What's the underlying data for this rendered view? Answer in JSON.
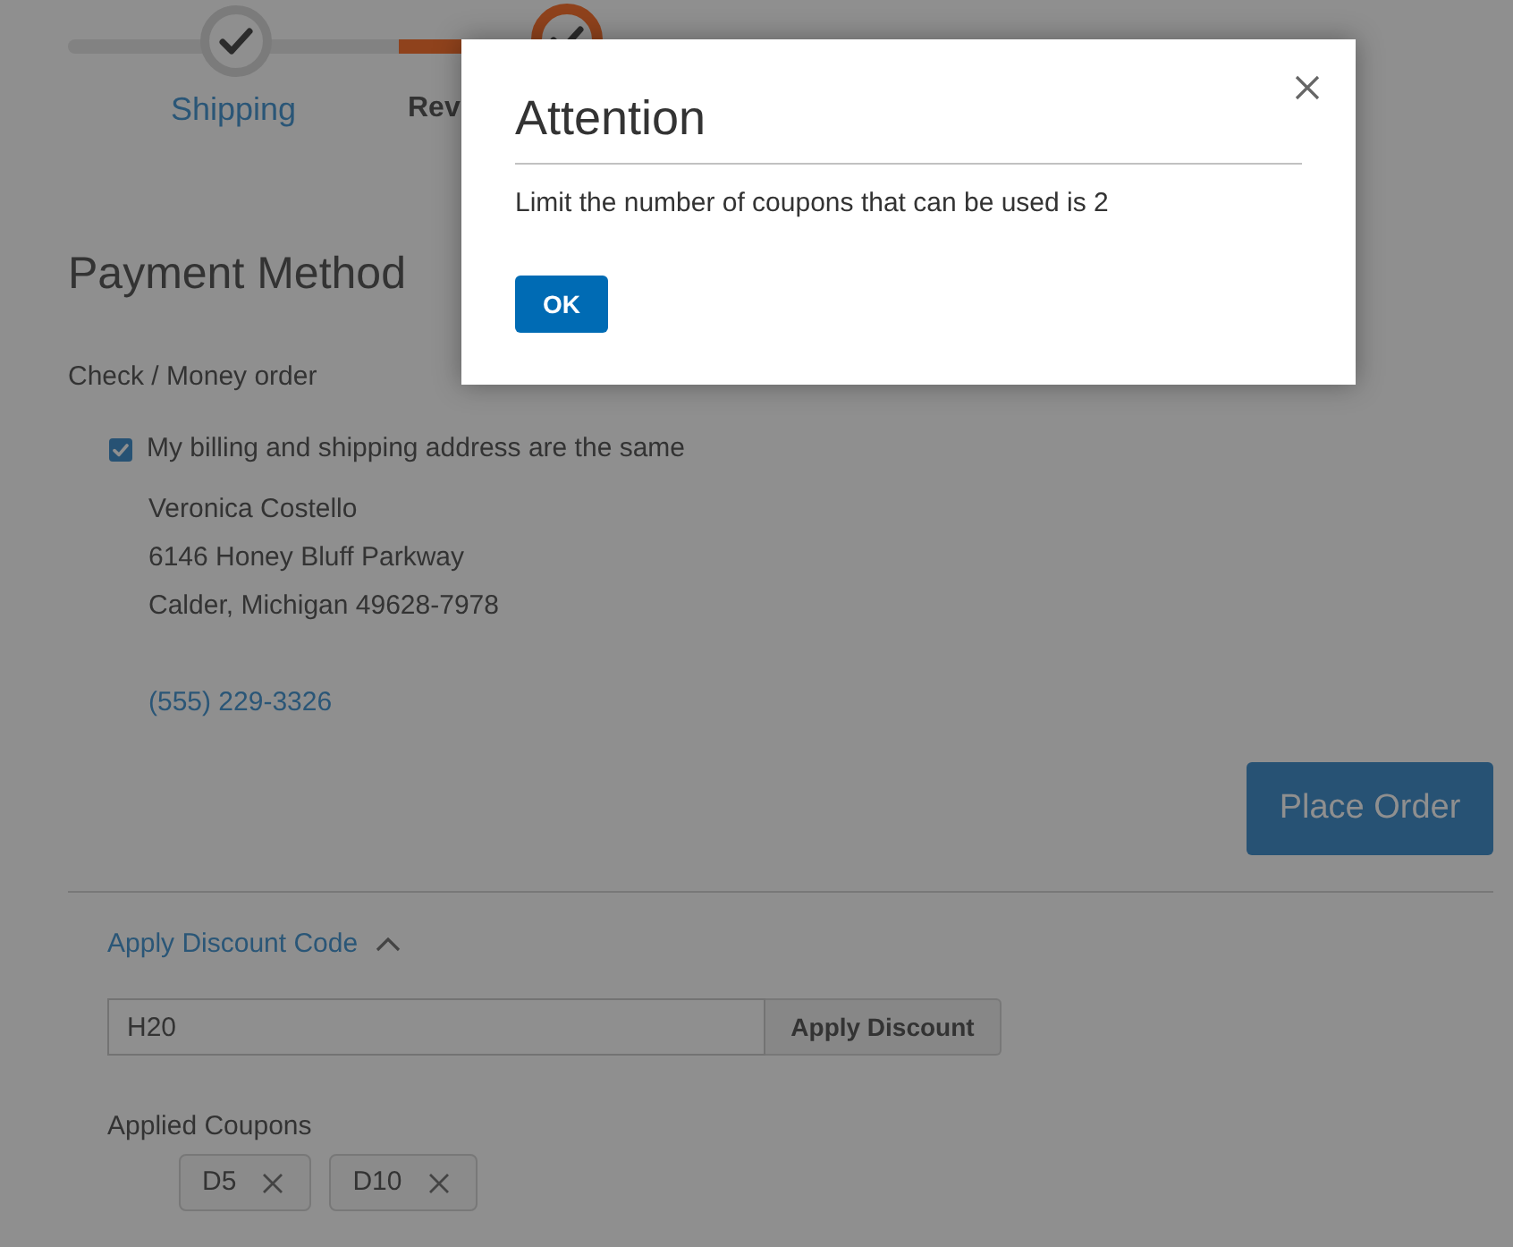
{
  "progress": {
    "steps": [
      {
        "label": "Shipping",
        "selected": false
      },
      {
        "label": "Rev",
        "selected": true
      }
    ]
  },
  "payment": {
    "title": "Payment Method",
    "method": "Check / Money order",
    "same_address": {
      "label": "My billing and shipping address are the same",
      "checked": true
    },
    "address_lines": [
      "Veronica Costello",
      "6146 Honey Bluff Parkway",
      "Calder, Michigan 49628-7978"
    ],
    "phone": "(555) 229-3326",
    "place_order_button": "Place Order"
  },
  "discount": {
    "toggle": "Apply Discount Code",
    "expanded": true,
    "code_input": {
      "value": "H20"
    },
    "apply_button": "Apply Discount",
    "applied_label": "Applied Coupons",
    "coupons": [
      {
        "code": "D5"
      },
      {
        "code": "D10"
      }
    ]
  },
  "modal": {
    "title": "Attention",
    "message": "Limit the number of coupons that can be used is 2",
    "ok_button": "OK"
  }
}
